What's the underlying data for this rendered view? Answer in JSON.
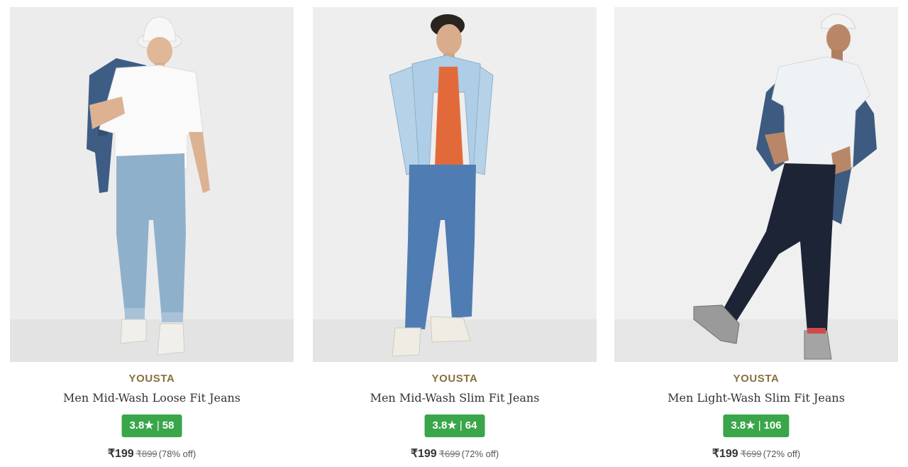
{
  "products": [
    {
      "brand": "YOUSTA",
      "title": "Men Mid-Wash Loose Fit Jeans",
      "rating": "3.8",
      "rating_star": "★",
      "rating_separator": "|",
      "rating_count": "58",
      "price": "₹199",
      "mrp": "₹899",
      "discount": "(78% off)",
      "jeans_color": "#8fb0cb",
      "top_color": "#f8f8f8"
    },
    {
      "brand": "YOUSTA",
      "title": "Men Mid-Wash Slim Fit Jeans",
      "rating": "3.8",
      "rating_star": "★",
      "rating_separator": "|",
      "rating_count": "64",
      "price": "₹199",
      "mrp": "₹699",
      "discount": "(72% off)",
      "jeans_color": "#4f7cb2",
      "top_color": "#aecde6"
    },
    {
      "brand": "YOUSTA",
      "title": "Men Light-Wash Slim Fit Jeans",
      "rating": "3.8",
      "rating_star": "★",
      "rating_separator": "|",
      "rating_count": "106",
      "price": "₹199",
      "mrp": "₹699",
      "discount": "(72% off)",
      "jeans_color": "#1d2436",
      "top_color": "#eff2f4"
    }
  ],
  "colors": {
    "brand_text": "#8a6e3e",
    "rating_badge": "#3aa64a",
    "photo_background": "#ededed"
  }
}
